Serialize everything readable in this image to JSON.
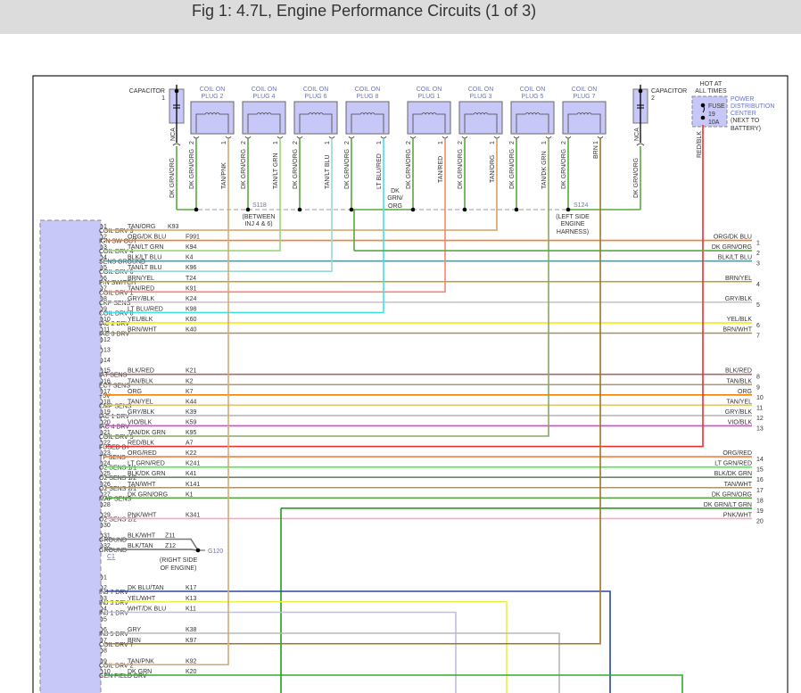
{
  "title": "Fig 1: 4.7L, Engine Performance Circuits (1 of 3)",
  "capacitors": [
    {
      "label": "CAPACITOR",
      "num": "1",
      "nca": "NCA",
      "wire": "DK GRN/ORG"
    },
    {
      "label": "CAPACITOR",
      "num": "2",
      "nca": "NCA",
      "wire": "DK GRN/ORG"
    }
  ],
  "coils": [
    {
      "l1": "COIL ON",
      "l2": "PLUG 2",
      "pin2": "2",
      "pin1": "1",
      "w2": "DK GRN/ORG",
      "w1": "TAN/PNK",
      "c1": "#d8a870"
    },
    {
      "l1": "COIL ON",
      "l2": "PLUG 4",
      "pin2": "2",
      "pin1": "1",
      "w2": "DK GRN/ORG",
      "w1": "TAN/LT GRN",
      "c1": "#98d878"
    },
    {
      "l1": "COIL ON",
      "l2": "PLUG 6",
      "pin2": "2",
      "pin1": "1",
      "w2": "DK GRN/ORG",
      "w1": "TAN/LT BLU",
      "c1": "#98d8d0"
    },
    {
      "l1": "COIL ON",
      "l2": "PLUG 8",
      "pin2": "2",
      "pin1": "1",
      "w2": "DK GRN/ORG",
      "w1": "LT BLU/RED",
      "c1": "#40d8f0"
    },
    {
      "l1": "COIL ON",
      "l2": "PLUG 1",
      "pin2": "2",
      "pin1": "1",
      "w2": "DK GRN/ORG",
      "w1": "TAN/RED",
      "c1": "#f09090"
    },
    {
      "l1": "COIL ON",
      "l2": "PLUG 3",
      "pin2": "2",
      "pin1": "1",
      "w2": "DK GRN/ORG",
      "w1": "TAN/ORG",
      "c1": "#d8a860"
    },
    {
      "l1": "COIL ON",
      "l2": "PLUG 5",
      "pin2": "2",
      "pin1": "1",
      "w2": "DK GRN/ORG",
      "w1": "TAN/DK GRN",
      "c1": "#90b878"
    },
    {
      "l1": "COIL ON",
      "l2": "PLUG 7",
      "pin2": "2",
      "pin1": "1",
      "w2": "DK GRN/ORG",
      "w1": "BRN",
      "c1": "#a07820"
    }
  ],
  "splices": {
    "s118": {
      "id": "S118",
      "l1": "(BETWEEN",
      "l2": "INJ 4 & 6)"
    },
    "s124": {
      "id": "S124",
      "l1": "(LEFT SIDE",
      "l2": "ENGINE",
      "l3": "HARNESS)"
    },
    "mid_wire": {
      "l1": "DK",
      "l2": "GRN/",
      "l3": "ORG"
    }
  },
  "fuse": {
    "hot1": "HOT AT",
    "hot2": "ALL TIMES",
    "name": "FUSE",
    "num": "19",
    "amps": "10A",
    "pdc1": "POWER",
    "pdc2": "DISTRIBUTION",
    "pdc3": "CENTER",
    "pdc4": "(NEXT TO",
    "pdc5": "BATTERY)",
    "wire": "RED/BLK"
  },
  "colors": {
    "dkgrnorg": "#58a840",
    "connector_fill": "#c8c8f8",
    "red": "#f02828"
  },
  "c1": {
    "label": "C1",
    "pins": [
      {
        "n": "1",
        "name": "COIL DRV 3",
        "wire": "TAN/ORG",
        "ckt": "K93",
        "hex": "#d8a060"
      },
      {
        "n": "2",
        "name": "IGN SW OUT",
        "wire": "ORG/DK BLU",
        "ckt": "F991",
        "hex": "#f08030"
      },
      {
        "n": "3",
        "name": "COIL DRV 4",
        "wire": "TAN/LT GRN",
        "ckt": "K94",
        "hex": "#98d878"
      },
      {
        "n": "4",
        "name": "SENS GROUND",
        "wire": "BLK/LT BLU",
        "ckt": "K4",
        "hex": "#5898a8"
      },
      {
        "n": "5",
        "name": "COIL DRV 6",
        "wire": "TAN/LT BLU",
        "ckt": "K96",
        "hex": "#98d8d0"
      },
      {
        "n": "6",
        "name": "P/N SWITCH",
        "wire": "BRN/YEL",
        "ckt": "T24",
        "hex": "#b8a030"
      },
      {
        "n": "7",
        "name": "COIL DRV 1",
        "wire": "TAN/RED",
        "ckt": "K91",
        "hex": "#f08870"
      },
      {
        "n": "8",
        "name": "CKP SENS",
        "wire": "GRY/BLK",
        "ckt": "K24",
        "hex": "#c8c8c8"
      },
      {
        "n": "9",
        "name": "COIL DRV 8",
        "wire": "LT BLU/RED",
        "ckt": "K98",
        "hex": "#40e0f0"
      },
      {
        "n": "10",
        "name": "IAC 2 DRV",
        "wire": "YEL/BLK",
        "ckt": "K60",
        "hex": "#f0f000"
      },
      {
        "n": "11",
        "name": "IAC 3 DRV",
        "wire": "BRN/WHT",
        "ckt": "K40",
        "hex": "#a89058"
      },
      {
        "n": "12",
        "name": "",
        "wire": "",
        "ckt": "",
        "hex": ""
      },
      {
        "n": "13",
        "name": "",
        "wire": "",
        "ckt": "",
        "hex": ""
      },
      {
        "n": "14",
        "name": "",
        "wire": "",
        "ckt": "",
        "hex": ""
      },
      {
        "n": "15",
        "name": "IAT SENS",
        "wire": "BLK/RED",
        "ckt": "K21",
        "hex": "#a86868"
      },
      {
        "n": "16",
        "name": "ECT SENS",
        "wire": "TAN/BLK",
        "ckt": "K2",
        "hex": "#a89878"
      },
      {
        "n": "17",
        "name": "+5V",
        "wire": "ORG",
        "ckt": "K7",
        "hex": "#f08000"
      },
      {
        "n": "18",
        "name": "CMP SENS",
        "wire": "TAN/YEL",
        "ckt": "K44",
        "hex": "#d8c868"
      },
      {
        "n": "19",
        "name": "IAC 1 DRV",
        "wire": "GRY/BLK",
        "ckt": "K39",
        "hex": "#b8b8b8"
      },
      {
        "n": "20",
        "name": "IAC 4 DRV",
        "wire": "VIO/BLK",
        "ckt": "K59",
        "hex": "#e040e0"
      },
      {
        "n": "21",
        "name": "COIL DRV 5",
        "wire": "TAN/DK GRN",
        "ckt": "K95",
        "hex": "#88a868"
      },
      {
        "n": "22",
        "name": "FUSED B+",
        "wire": "RED/BLK",
        "ckt": "A7",
        "hex": "#f03030"
      },
      {
        "n": "23",
        "name": "TP SENS",
        "wire": "ORG/RED",
        "ckt": "K22",
        "hex": "#f08040"
      },
      {
        "n": "24",
        "name": "O2 SENS 1/1",
        "wire": "LT GRN/RED",
        "ckt": "K241",
        "hex": "#40f040"
      },
      {
        "n": "25",
        "name": "O2 SENS 1/2",
        "wire": "BLK/DK GRN",
        "ckt": "K41",
        "hex": "#688868"
      },
      {
        "n": "26",
        "name": "O2 SENS 2/1",
        "wire": "TAN/WHT",
        "ckt": "K141",
        "hex": "#a89868"
      },
      {
        "n": "27",
        "name": "MAP SENS",
        "wire": "DK GRN/ORG",
        "ckt": "K1",
        "hex": "#58a840"
      },
      {
        "n": "28",
        "name": "",
        "wire": "",
        "ckt": "",
        "hex": ""
      },
      {
        "n": "29",
        "name": "O2 SENS 2/2",
        "wire": "PNK/WHT",
        "ckt": "K341",
        "hex": "#f8a8c8"
      },
      {
        "n": "30",
        "name": "",
        "wire": "",
        "ckt": "",
        "hex": ""
      },
      {
        "n": "31",
        "name": "GROUND",
        "wire": "BLK/WHT",
        "ckt": "Z11",
        "hex": "#777777"
      },
      {
        "n": "32",
        "name": "GROUND",
        "wire": "BLK/TAN",
        "ckt": "Z12",
        "hex": "#777777"
      }
    ]
  },
  "ground": {
    "id": "G120",
    "l1": "(RIGHT SIDE",
    "l2": "OF ENGINE)"
  },
  "c2": {
    "pins": [
      {
        "n": "1",
        "name": "",
        "wire": "",
        "ckt": "",
        "hex": ""
      },
      {
        "n": "2",
        "name": "INJ 7 DRV",
        "wire": "DK BLU/TAN",
        "ckt": "K17",
        "hex": "#2848a8"
      },
      {
        "n": "3",
        "name": "INJ 3 DRV",
        "wire": "YEL/WHT",
        "ckt": "K13",
        "hex": "#f0f040"
      },
      {
        "n": "4",
        "name": "INJ 1 DRV",
        "wire": "WHT/DK BLU",
        "ckt": "K11",
        "hex": "#c0c0d8"
      },
      {
        "n": "5",
        "name": "",
        "wire": "",
        "ckt": "",
        "hex": ""
      },
      {
        "n": "6",
        "name": "INJ 5 DRV",
        "wire": "GRY",
        "ckt": "K38",
        "hex": "#b8b8b8"
      },
      {
        "n": "7",
        "name": "COIL DRV 7",
        "wire": "BRN",
        "ckt": "K97",
        "hex": "#a07820"
      },
      {
        "n": "8",
        "name": "",
        "wire": "",
        "ckt": "",
        "hex": ""
      },
      {
        "n": "9",
        "name": "COIL DRV 2",
        "wire": "TAN/PNK",
        "ckt": "K92",
        "hex": "#d8a870"
      },
      {
        "n": "10",
        "name": "GEN FIELD DRV",
        "wire": "DK GRN",
        "ckt": "K20",
        "hex": "#30a830"
      }
    ]
  },
  "right_connector": [
    {
      "n": "1",
      "wire": "ORG/DK BLU",
      "hex": "#f08030"
    },
    {
      "n": "2",
      "wire": "DK GRN/ORG",
      "hex": "#58a840"
    },
    {
      "n": "3",
      "wire": "BLK/LT BLU",
      "hex": "#5898a8"
    },
    {
      "n": "4",
      "wire": "BRN/YEL",
      "hex": "#b8a030"
    },
    {
      "n": "5",
      "wire": "GRY/BLK",
      "hex": "#c8c8c8"
    },
    {
      "n": "6",
      "wire": "YEL/BLK",
      "hex": "#f0f000"
    },
    {
      "n": "7",
      "wire": "BRN/WHT",
      "hex": "#a89058"
    },
    {
      "n": "8",
      "wire": "BLK/RED",
      "hex": "#a86868"
    },
    {
      "n": "9",
      "wire": "TAN/BLK",
      "hex": "#a89878"
    },
    {
      "n": "10",
      "wire": "ORG",
      "hex": "#f08000"
    },
    {
      "n": "11",
      "wire": "TAN/YEL",
      "hex": "#d8c868"
    },
    {
      "n": "12",
      "wire": "GRY/BLK",
      "hex": "#b8b8b8"
    },
    {
      "n": "13",
      "wire": "VIO/BLK",
      "hex": "#e040e0"
    },
    {
      "n": "14",
      "wire": "ORG/RED",
      "hex": "#f08040"
    },
    {
      "n": "15",
      "wire": "LT GRN/RED",
      "hex": "#40f040"
    },
    {
      "n": "16",
      "wire": "BLK/DK GRN",
      "hex": "#688868"
    },
    {
      "n": "17",
      "wire": "TAN/WHT",
      "hex": "#a89868"
    },
    {
      "n": "18",
      "wire": "DK GRN/ORG",
      "hex": "#58a840"
    },
    {
      "n": "19",
      "wire": "DK GRN/LT GRN",
      "hex": "#20a020"
    },
    {
      "n": "20",
      "wire": "PNK/WHT",
      "hex": "#f8a8c8"
    }
  ]
}
